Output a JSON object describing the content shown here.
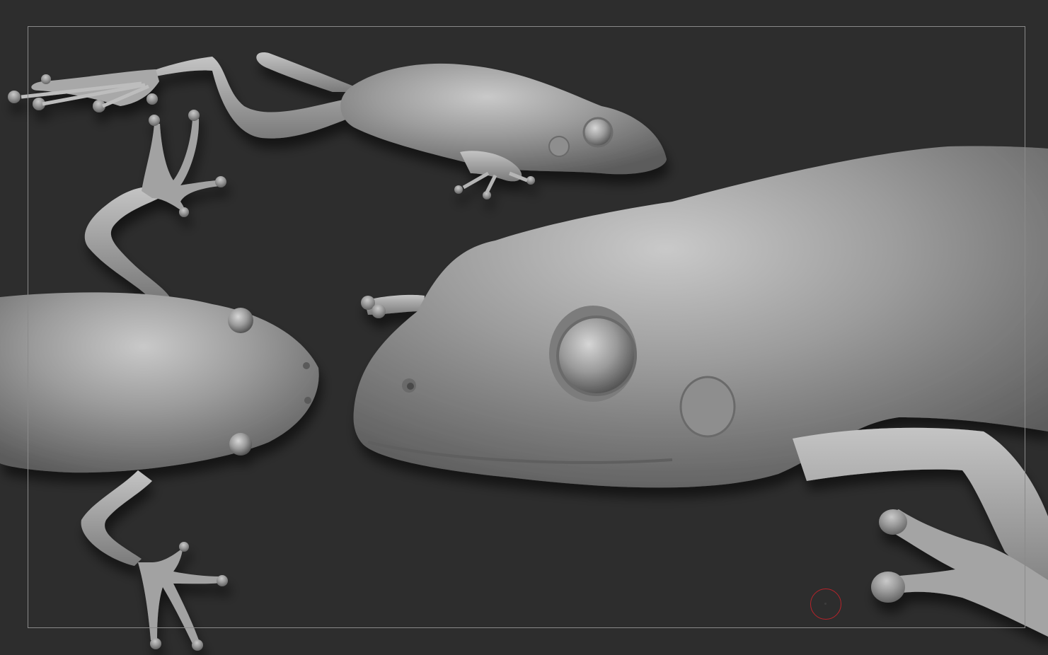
{
  "app": {
    "viewport_background": "#2d2d2d",
    "document_frame_color": "#8a8a8a",
    "brush_cursor_color": "#b8232a"
  },
  "scene": {
    "models": [
      {
        "name": "frog-side-view",
        "material_color": "#9a9a9a"
      },
      {
        "name": "frog-top-view",
        "material_color": "#9a9a9a"
      },
      {
        "name": "frog-closeup-view",
        "material_color": "#9a9a9a"
      }
    ]
  }
}
